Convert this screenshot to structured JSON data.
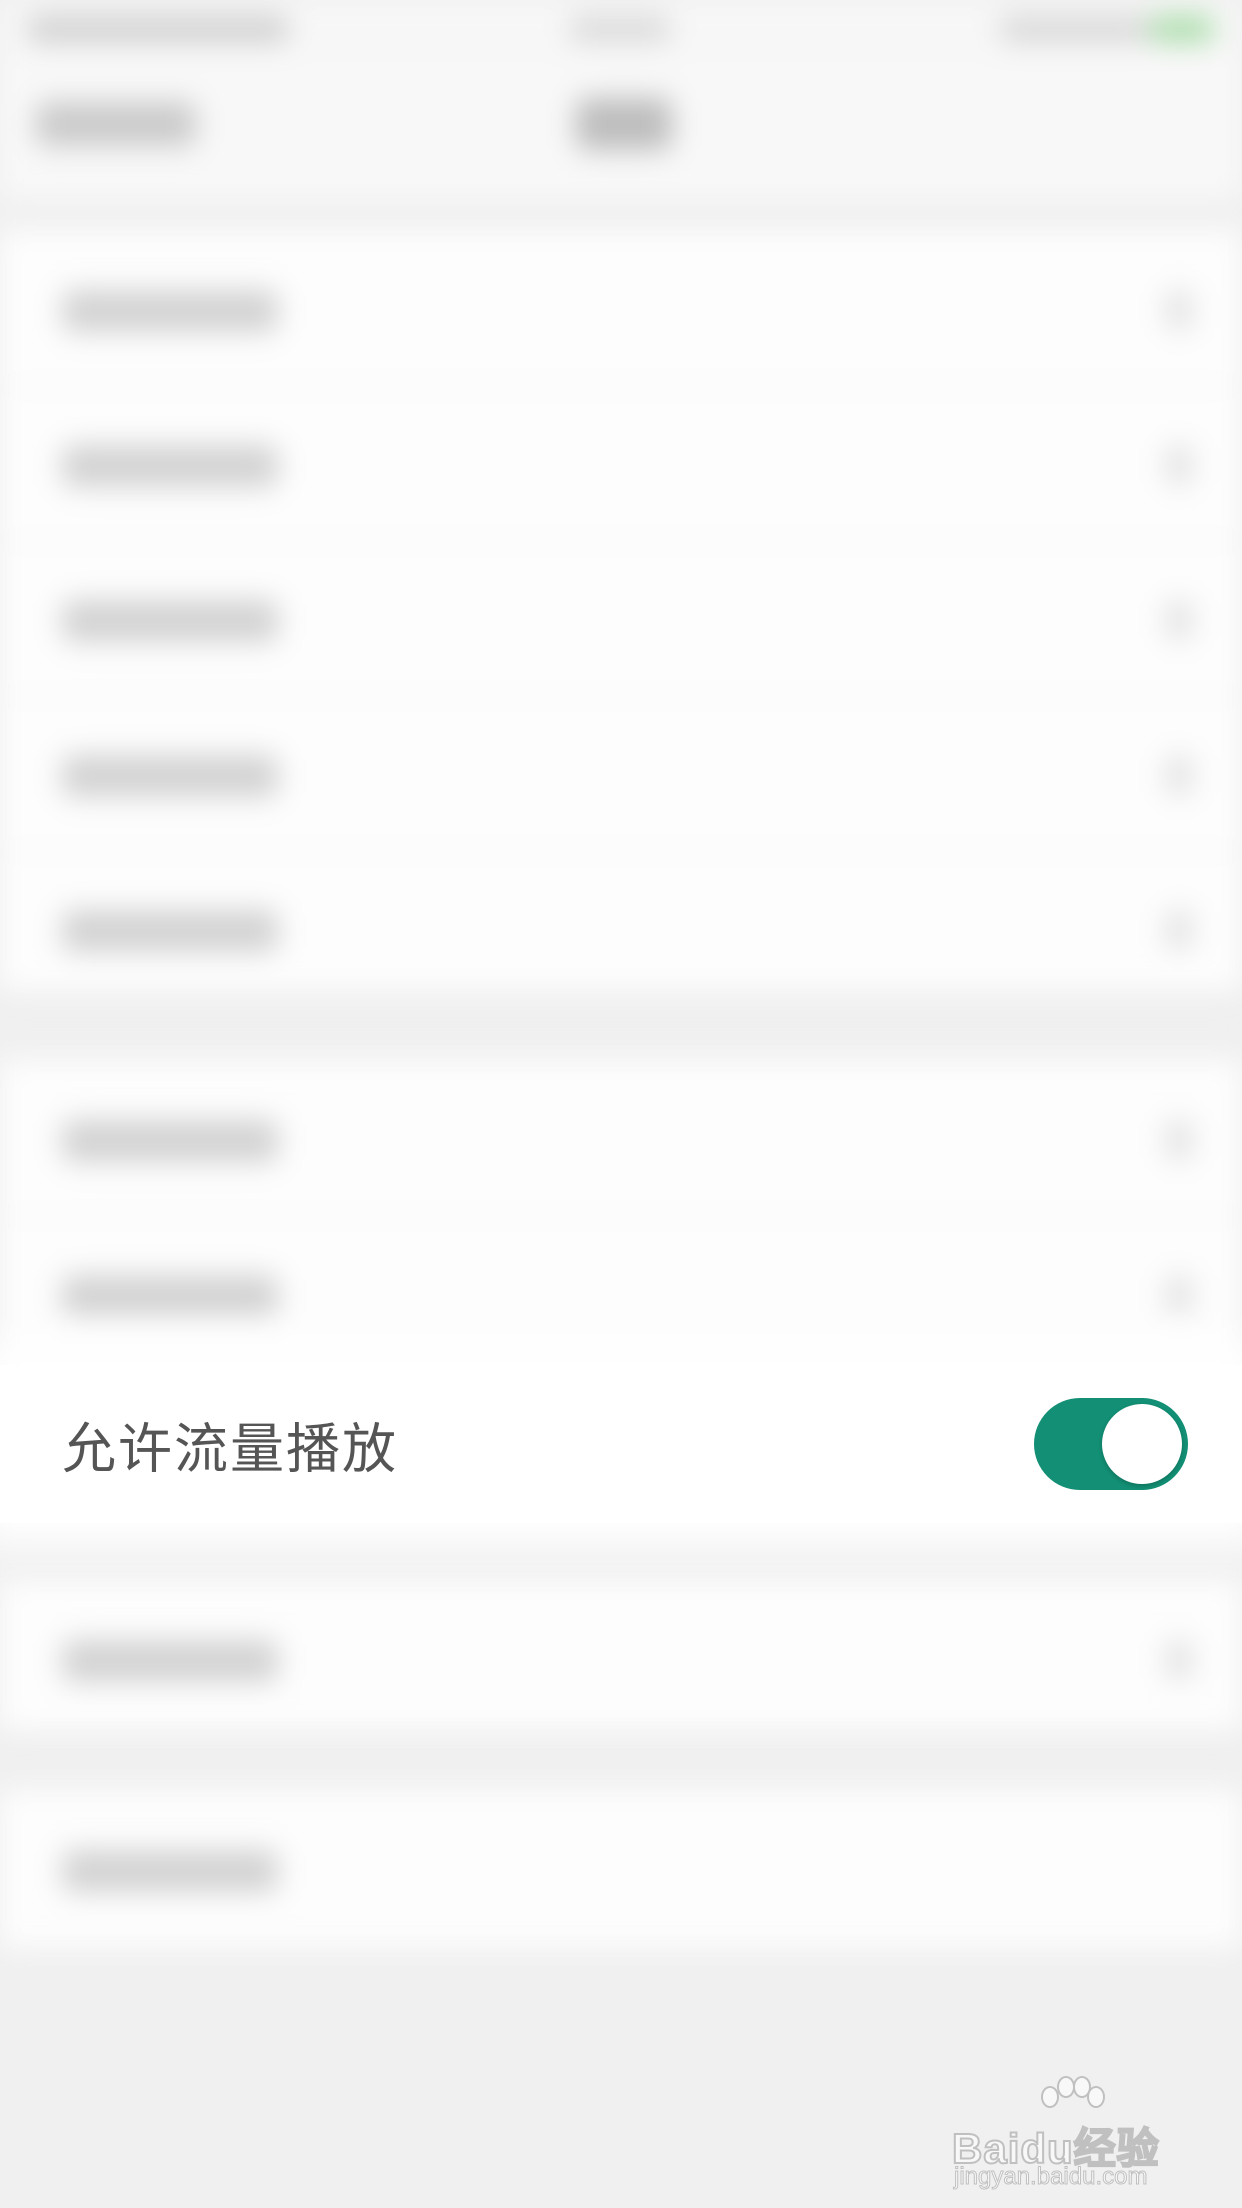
{
  "settings": {
    "focused_row": {
      "label": "允许流量播放",
      "toggle_on": true,
      "toggle_color": "#128f74"
    }
  },
  "watermark": {
    "logo": "Baidu经验",
    "url": "jingyan.baidu.com"
  },
  "colors": {
    "background": "#f0f0f0",
    "row_background": "#ffffff",
    "label_text": "#555555"
  }
}
